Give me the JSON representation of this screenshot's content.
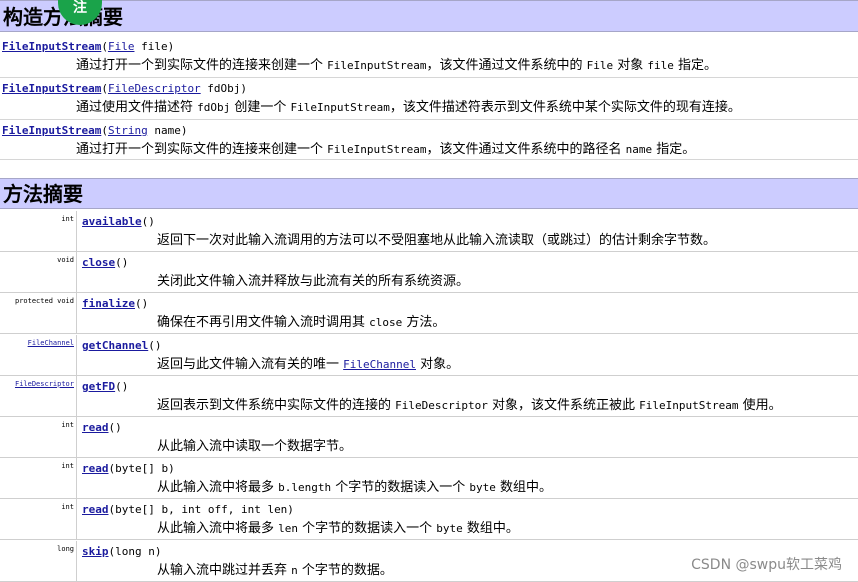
{
  "constructor_header": {
    "title": "构造方法摘要",
    "stamp": "注"
  },
  "constructors": [
    {
      "name": "FileInputStream",
      "param_type": "File",
      "param_rest": " file)",
      "desc": [
        {
          "t": "text",
          "v": "通过打开一个到实际文件的连接来创建一个 "
        },
        {
          "t": "code",
          "v": "FileInputStream"
        },
        {
          "t": "text",
          "v": "，该文件通过文件系统中的 "
        },
        {
          "t": "code",
          "v": "File"
        },
        {
          "t": "text",
          "v": " 对象 "
        },
        {
          "t": "code",
          "v": "file"
        },
        {
          "t": "text",
          "v": " 指定。"
        }
      ]
    },
    {
      "name": "FileInputStream",
      "param_type": "FileDescriptor",
      "param_rest": " fdObj)",
      "desc": [
        {
          "t": "text",
          "v": "通过使用文件描述符 "
        },
        {
          "t": "code",
          "v": "fdObj"
        },
        {
          "t": "text",
          "v": " 创建一个 "
        },
        {
          "t": "code",
          "v": "FileInputStream"
        },
        {
          "t": "text",
          "v": "，该文件描述符表示到文件系统中某个实际文件的现有连接。"
        }
      ]
    },
    {
      "name": "FileInputStream",
      "param_type": "String",
      "param_rest": " name)",
      "desc": [
        {
          "t": "text",
          "v": "通过打开一个到实际文件的连接来创建一个 "
        },
        {
          "t": "code",
          "v": "FileInputStream"
        },
        {
          "t": "text",
          "v": "，该文件通过文件系统中的路径名 "
        },
        {
          "t": "code",
          "v": "name"
        },
        {
          "t": "text",
          "v": " 指定。"
        }
      ]
    }
  ],
  "method_header": {
    "title": "方法摘要"
  },
  "methods": [
    {
      "modifier": "int",
      "mod_link": false,
      "name": "available",
      "params": "()",
      "desc": [
        {
          "t": "text",
          "v": "返回下一次对此输入流调用的方法可以不受阻塞地从此输入流读取（或跳过）的估计剩余字节数。"
        }
      ]
    },
    {
      "modifier": "void",
      "mod_link": false,
      "name": "close",
      "params": "()",
      "desc": [
        {
          "t": "text",
          "v": "关闭此文件输入流并释放与此流有关的所有系统资源。"
        }
      ]
    },
    {
      "modifier": "protected  void",
      "mod_link": false,
      "name": "finalize",
      "params": "()",
      "desc": [
        {
          "t": "text",
          "v": "确保在不再引用文件输入流时调用其 "
        },
        {
          "t": "code",
          "v": "close"
        },
        {
          "t": "text",
          "v": " 方法。"
        }
      ]
    },
    {
      "modifier": "FileChannel",
      "mod_link": true,
      "name": "getChannel",
      "params": "()",
      "desc": [
        {
          "t": "text",
          "v": "返回与此文件输入流有关的唯一 "
        },
        {
          "t": "link",
          "v": "FileChannel"
        },
        {
          "t": "text",
          "v": " 对象。"
        }
      ]
    },
    {
      "modifier": "FileDescriptor",
      "mod_link": true,
      "name": "getFD",
      "params": "()",
      "desc": [
        {
          "t": "text",
          "v": "返回表示到文件系统中实际文件的连接的 "
        },
        {
          "t": "code",
          "v": "FileDescriptor"
        },
        {
          "t": "text",
          "v": " 对象，该文件系统正被此 "
        },
        {
          "t": "code",
          "v": "FileInputStream"
        },
        {
          "t": "text",
          "v": " 使用。"
        }
      ]
    },
    {
      "modifier": "int",
      "mod_link": false,
      "name": "read",
      "params": "()",
      "desc": [
        {
          "t": "text",
          "v": "从此输入流中读取一个数据字节。"
        }
      ]
    },
    {
      "modifier": "int",
      "mod_link": false,
      "name": "read",
      "params": "(byte[] b)",
      "desc": [
        {
          "t": "text",
          "v": "从此输入流中将最多 "
        },
        {
          "t": "code",
          "v": "b.length"
        },
        {
          "t": "text",
          "v": " 个字节的数据读入一个 "
        },
        {
          "t": "code",
          "v": "byte"
        },
        {
          "t": "text",
          "v": " 数组中。"
        }
      ]
    },
    {
      "modifier": "int",
      "mod_link": false,
      "name": "read",
      "params": "(byte[] b,  int off,  int len)",
      "desc": [
        {
          "t": "text",
          "v": "从此输入流中将最多 "
        },
        {
          "t": "code",
          "v": "len"
        },
        {
          "t": "text",
          "v": " 个字节的数据读入一个 "
        },
        {
          "t": "code",
          "v": "byte"
        },
        {
          "t": "text",
          "v": " 数组中。"
        }
      ]
    },
    {
      "modifier": "long",
      "mod_link": false,
      "name": "skip",
      "params": "(long n)",
      "desc": [
        {
          "t": "text",
          "v": "从输入流中跳过并丢弃 "
        },
        {
          "t": "code",
          "v": "n"
        },
        {
          "t": "text",
          "v": " 个字节的数据。"
        }
      ]
    }
  ],
  "watermark": "CSDN @swpu软工菜鸡"
}
